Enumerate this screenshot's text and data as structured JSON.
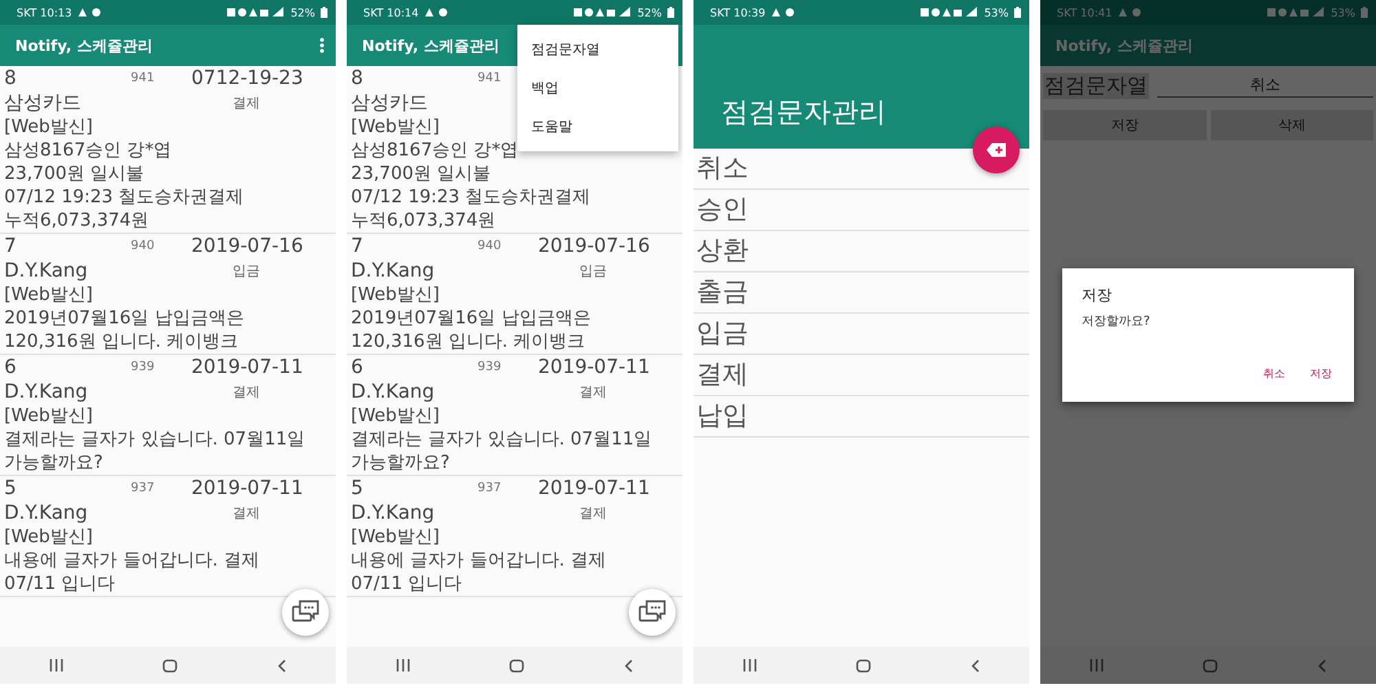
{
  "screens": [
    {
      "kind": "messages",
      "status": {
        "carrier_time": "SKT 10:13",
        "battery": "52%"
      },
      "app_bar": {
        "title": "Notify, 스케쥴관리"
      },
      "messages": [
        {
          "number": "8",
          "id": "941",
          "date": "0712-19-23",
          "sender": "삼성카드",
          "category": "결제",
          "body": [
            "[Web발신]",
            "삼성8167승인 강*엽",
            "23,700원 일시불",
            "07/12 19:23 철도승차권결제",
            "누적6,073,374원"
          ]
        },
        {
          "number": "7",
          "id": "940",
          "date": "2019-07-16",
          "sender": "D.Y.Kang",
          "category": "입금",
          "body": [
            "[Web발신]",
            "2019년07월16일 납입금액은",
            "120,316원 입니다. 케이뱅크"
          ]
        },
        {
          "number": "6",
          "id": "939",
          "date": "2019-07-11",
          "sender": "D.Y.Kang",
          "category": "결제",
          "body": [
            "[Web발신]",
            "결제라는 글자가 있습니다. 07월11일",
            "가능할까요?"
          ]
        },
        {
          "number": "5",
          "id": "937",
          "date": "2019-07-11",
          "sender": "D.Y.Kang",
          "category": "결제",
          "body": [
            "[Web발신]",
            "내용에 글자가 들어갑니다. 결제",
            "07/11 입니다"
          ]
        }
      ]
    },
    {
      "kind": "messages",
      "status": {
        "carrier_time": "SKT 10:14",
        "battery": "52%"
      },
      "app_bar": {
        "title": "Notify, 스케쥴관리"
      },
      "menu": {
        "items": [
          "점검문자열",
          "백업",
          "도움말"
        ]
      },
      "messages": [
        {
          "number": "8",
          "id": "941",
          "sender": "삼성카드",
          "body": [
            "[Web발신]",
            "삼성8167승인 강*엽",
            "23,700원 일시불",
            "07/12 19:23 철도승차권결제",
            "누적6,073,374원"
          ]
        },
        {
          "number": "7",
          "id": "940",
          "date": "2019-07-16",
          "sender": "D.Y.Kang",
          "category": "입금",
          "body": [
            "[Web발신]",
            "2019년07월16일 납입금액은",
            "120,316원 입니다. 케이뱅크"
          ]
        },
        {
          "number": "6",
          "id": "939",
          "date": "2019-07-11",
          "sender": "D.Y.Kang",
          "category": "결제",
          "body": [
            "[Web발신]",
            "결제라는 글자가 있습니다. 07월11일",
            "가능할까요?"
          ]
        },
        {
          "number": "5",
          "id": "937",
          "date": "2019-07-11",
          "sender": "D.Y.Kang",
          "category": "결제",
          "body": [
            "[Web발신]",
            "내용에 글자가 들어갑니다. 결제",
            "07/11 입니다"
          ]
        }
      ]
    },
    {
      "kind": "manage",
      "status": {
        "carrier_time": "SKT 10:39",
        "battery": "53%"
      },
      "app_bar": {
        "title": "점검문자관리"
      },
      "items": [
        "취소",
        "승인",
        "상환",
        "출금",
        "입금",
        "결제",
        "납입"
      ]
    },
    {
      "kind": "editor",
      "status": {
        "carrier_time": "SKT 10:41",
        "battery": "53%"
      },
      "app_bar": {
        "title": "Notify, 스케쥴관리"
      },
      "form": {
        "label": "점검문자열",
        "value": "취소",
        "buttons": [
          "저장",
          "삭제"
        ]
      },
      "dialog": {
        "title": "저장",
        "message": "저장할까요?",
        "buttons": [
          "취소",
          "저장"
        ]
      }
    }
  ]
}
